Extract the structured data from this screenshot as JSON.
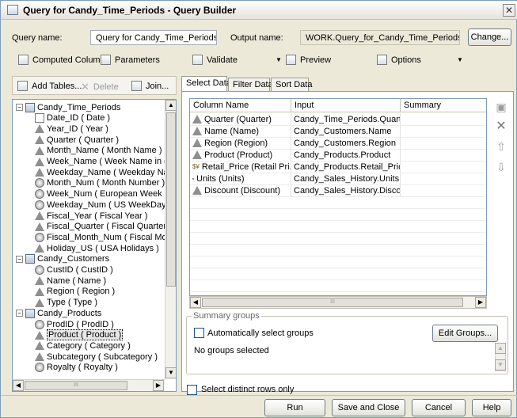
{
  "window": {
    "title": "Query for Candy_Time_Periods - Query Builder",
    "close_glyph": "✕"
  },
  "form": {
    "query_name_label": "Query name:",
    "query_name_value": "Query for Candy_Time_Periods",
    "output_name_label": "Output name:",
    "output_name_value": "WORK.Query_for_Candy_Time_Periods",
    "change_button": "Change..."
  },
  "toolbar": {
    "computed_columns": "Computed Columns",
    "parameters": "Parameters",
    "validate": "Validate",
    "preview": "Preview",
    "options": "Options"
  },
  "left_toolbar": {
    "add_tables": "Add Tables...",
    "delete": "Delete",
    "join": "Join..."
  },
  "tree": {
    "items": [
      {
        "label": "Candy_Time_Periods",
        "icon": "table",
        "level": 0,
        "expander": "−"
      },
      {
        "label": "Date_ID ( Date )",
        "icon": "date",
        "level": 1
      },
      {
        "label": "Year_ID ( Year )",
        "icon": "char",
        "level": 1
      },
      {
        "label": "Quarter ( Quarter )",
        "icon": "char",
        "level": 1
      },
      {
        "label": "Month_Name ( Month Name )",
        "icon": "char",
        "level": 1
      },
      {
        "label": "Week_Name ( Week Name in d",
        "icon": "char",
        "level": 1
      },
      {
        "label": "Weekday_Name ( Weekday Na",
        "icon": "char",
        "level": 1
      },
      {
        "label": "Month_Num ( Month Number )",
        "icon": "num",
        "level": 1
      },
      {
        "label": "Week_Num ( European Week N",
        "icon": "num",
        "level": 1
      },
      {
        "label": "Weekday_Num ( US WeekDay",
        "icon": "num",
        "level": 1
      },
      {
        "label": "Fiscal_Year ( Fiscal Year )",
        "icon": "char",
        "level": 1
      },
      {
        "label": "Fiscal_Quarter ( Fiscal Quarter )",
        "icon": "char",
        "level": 1
      },
      {
        "label": "Fiscal_Month_Num ( Fiscal Mont",
        "icon": "num",
        "level": 1
      },
      {
        "label": "Holiday_US ( USA Holidays )",
        "icon": "char",
        "level": 1
      },
      {
        "label": "Candy_Customers",
        "icon": "table",
        "level": 0,
        "expander": "−"
      },
      {
        "label": "CustID ( CustID )",
        "icon": "num",
        "level": 1
      },
      {
        "label": "Name ( Name )",
        "icon": "char",
        "level": 1
      },
      {
        "label": "Region ( Region )",
        "icon": "char",
        "level": 1
      },
      {
        "label": "Type ( Type )",
        "icon": "char",
        "level": 1
      },
      {
        "label": "Candy_Products",
        "icon": "table",
        "level": 0,
        "expander": "−"
      },
      {
        "label": "ProdID ( ProdID )",
        "icon": "num",
        "level": 1
      },
      {
        "label": "Product ( Product )",
        "icon": "char",
        "level": 1,
        "selected": true
      },
      {
        "label": "Category ( Category )",
        "icon": "char",
        "level": 1
      },
      {
        "label": "Subcategory ( Subcategory )",
        "icon": "char",
        "level": 1
      },
      {
        "label": "Royalty ( Royalty )",
        "icon": "num",
        "level": 1
      }
    ]
  },
  "tabs": [
    {
      "label": "Select Data",
      "active": true
    },
    {
      "label": "Filter Data",
      "active": false
    },
    {
      "label": "Sort Data",
      "active": false
    }
  ],
  "grid": {
    "headers": [
      "Column Name",
      "Input",
      "Summary"
    ],
    "rows": [
      {
        "name": "Quarter (Quarter)",
        "input": "Candy_Time_Periods.Quarter",
        "summary": "",
        "icon": "char"
      },
      {
        "name": "Name (Name)",
        "input": "Candy_Customers.Name",
        "summary": "",
        "icon": "char"
      },
      {
        "name": "Region (Region)",
        "input": "Candy_Customers.Region",
        "summary": "",
        "icon": "char"
      },
      {
        "name": "Product (Product)",
        "input": "Candy_Products.Product",
        "summary": "",
        "icon": "char"
      },
      {
        "name": "Retail_Price (Retail Pri...",
        "input": "Candy_Products.Retail_Price",
        "summary": "",
        "icon": "currency"
      },
      {
        "name": "Units (Units)",
        "input": "Candy_Sales_History.Units",
        "summary": "",
        "icon": "num"
      },
      {
        "name": "Discount (Discount)",
        "input": "Candy_Sales_History.Discount",
        "summary": "",
        "icon": "char"
      }
    ]
  },
  "summary_groups": {
    "title": "Summary groups",
    "auto_select_label": "Automatically select groups",
    "auto_select_checked": false,
    "edit_groups_button": "Edit Groups...",
    "no_groups_text": "No groups selected"
  },
  "distinct": {
    "label": "Select distinct rows only",
    "checked": false
  },
  "footer": {
    "run": "Run",
    "save_close": "Save and Close",
    "cancel": "Cancel",
    "help": "Help"
  },
  "scroll": {
    "up": "▲",
    "down": "▼",
    "left": "◀",
    "right": "▶",
    "grip": "III",
    "dropdown": "▼"
  }
}
